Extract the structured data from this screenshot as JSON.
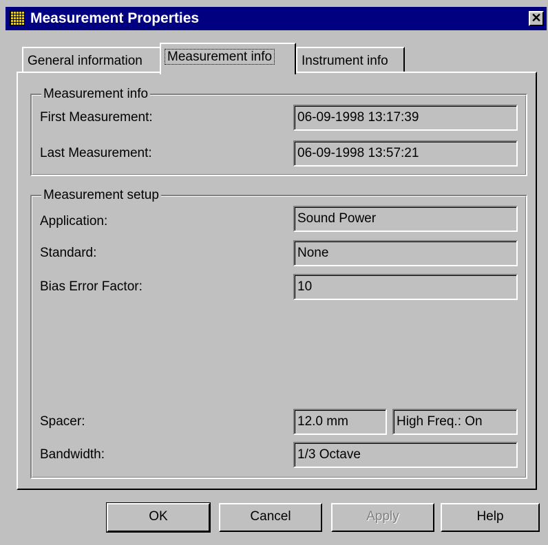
{
  "window": {
    "title": "Measurement Properties",
    "close_glyph": "✕"
  },
  "tabs": [
    {
      "label": "General information"
    },
    {
      "label": "Measurement info"
    },
    {
      "label": "Instrument info"
    }
  ],
  "measurement_info": {
    "legend": "Measurement info",
    "first_label": "First Measurement:",
    "first_value": "06-09-1998 13:17:39",
    "last_label": "Last Measurement:",
    "last_value": "06-09-1998 13:57:21"
  },
  "measurement_setup": {
    "legend": "Measurement setup",
    "application_label": "Application:",
    "application_value": "Sound Power",
    "standard_label": "Standard:",
    "standard_value": "None",
    "bias_label": "Bias Error Factor:",
    "bias_value": "10",
    "spacer_label": "Spacer:",
    "spacer_value": "12.0 mm",
    "high_freq_value": "High Freq.: On",
    "bandwidth_label": "Bandwidth:",
    "bandwidth_value": "1/3 Octave"
  },
  "buttons": {
    "ok": "OK",
    "cancel": "Cancel",
    "apply": "Apply",
    "help": "Help"
  },
  "icons": {
    "title_icon": "grid-app-icon",
    "close_icon": "close-icon"
  }
}
